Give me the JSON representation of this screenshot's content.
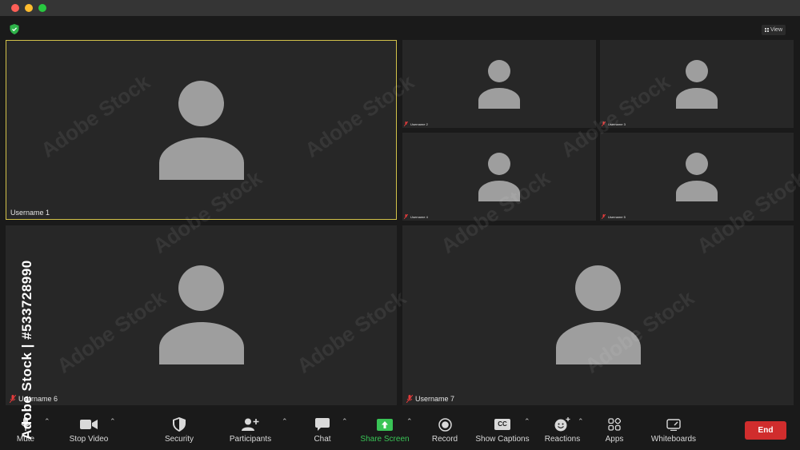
{
  "view_label": "View",
  "participants": [
    {
      "name": "Username 1",
      "muted": false
    },
    {
      "name": "Username 2",
      "muted": true
    },
    {
      "name": "Username 3",
      "muted": true
    },
    {
      "name": "Username 4",
      "muted": true
    },
    {
      "name": "Username 5",
      "muted": true
    },
    {
      "name": "Username 6",
      "muted": true
    },
    {
      "name": "Username 7",
      "muted": true
    }
  ],
  "toolbar": {
    "mute": "Mute",
    "stop_video": "Stop Video",
    "security": "Security",
    "participants": "Participants",
    "chat": "Chat",
    "share_screen": "Share Screen",
    "record": "Record",
    "show_captions": "Show Captions",
    "captions_badge": "CC",
    "reactions": "Reactions",
    "apps": "Apps",
    "whiteboards": "Whiteboards",
    "end": "End"
  },
  "watermark": {
    "text": "Adobe Stock",
    "stock_id": "Adobe Stock | #533728990"
  },
  "colors": {
    "active_speaker_border": "#d3c24a",
    "end_button": "#d02d2d",
    "share_screen": "#39c456",
    "muted_mic": "#e23b3b"
  }
}
